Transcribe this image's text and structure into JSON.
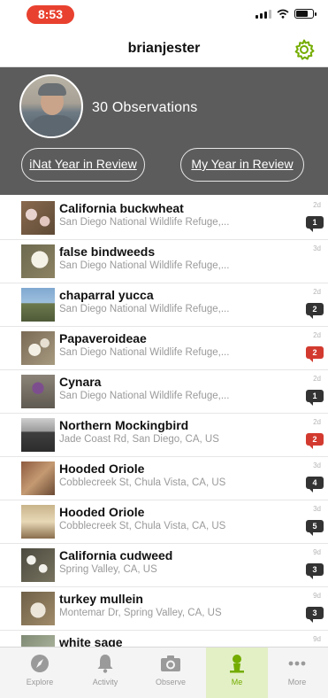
{
  "status_bar": {
    "time": "8:53"
  },
  "header": {
    "username": "brianjester"
  },
  "profile": {
    "observations_label": "30 Observations",
    "inat_year_button": "iNat Year in Review",
    "my_year_button": "My Year in Review"
  },
  "observations": [
    {
      "name": "California buckwheat",
      "place": "San Diego National Wildlife Refuge,...",
      "age": "2d",
      "comments": "1",
      "badge_color": "#333333"
    },
    {
      "name": "false bindweeds",
      "place": "San Diego National Wildlife Refuge,...",
      "age": "3d",
      "comments": "",
      "badge_color": ""
    },
    {
      "name": "chaparral yucca",
      "place": "San Diego National Wildlife Refuge,...",
      "age": "2d",
      "comments": "2",
      "badge_color": "#333333"
    },
    {
      "name": "Papaveroideae",
      "place": "San Diego National Wildlife Refuge,...",
      "age": "2d",
      "comments": "2",
      "badge_color": "#d33a2f"
    },
    {
      "name": "Cynara",
      "place": "San Diego National Wildlife Refuge,...",
      "age": "2d",
      "comments": "1",
      "badge_color": "#333333"
    },
    {
      "name": "Northern Mockingbird",
      "place": "Jade Coast Rd, San Diego, CA, US",
      "age": "2d",
      "comments": "2",
      "badge_color": "#d33a2f"
    },
    {
      "name": "Hooded Oriole",
      "place": "Cobblecreek St, Chula Vista, CA, US",
      "age": "3d",
      "comments": "4",
      "badge_color": "#333333"
    },
    {
      "name": "Hooded Oriole",
      "place": "Cobblecreek St, Chula Vista, CA, US",
      "age": "3d",
      "comments": "5",
      "badge_color": "#333333"
    },
    {
      "name": "California cudweed",
      "place": "Spring Valley, CA, US",
      "age": "9d",
      "comments": "3",
      "badge_color": "#333333"
    },
    {
      "name": "turkey mullein",
      "place": "Montemar Dr, Spring Valley, CA, US",
      "age": "9d",
      "comments": "3",
      "badge_color": "#333333"
    },
    {
      "name": "white sage",
      "place": "",
      "age": "9d",
      "comments": "",
      "badge_color": ""
    }
  ],
  "tabs": [
    {
      "label": "Explore",
      "icon": "compass-icon",
      "active": false
    },
    {
      "label": "Activity",
      "icon": "bell-icon",
      "active": false
    },
    {
      "label": "Observe",
      "icon": "camera-icon",
      "active": false
    },
    {
      "label": "Me",
      "icon": "person-icon",
      "active": true
    },
    {
      "label": "More",
      "icon": "more-dots-icon",
      "active": false
    }
  ],
  "colors": {
    "accent": "#74ac00",
    "banner": "#5c5c5c",
    "alert": "#d33a2f",
    "time_pill": "#e8412f"
  }
}
